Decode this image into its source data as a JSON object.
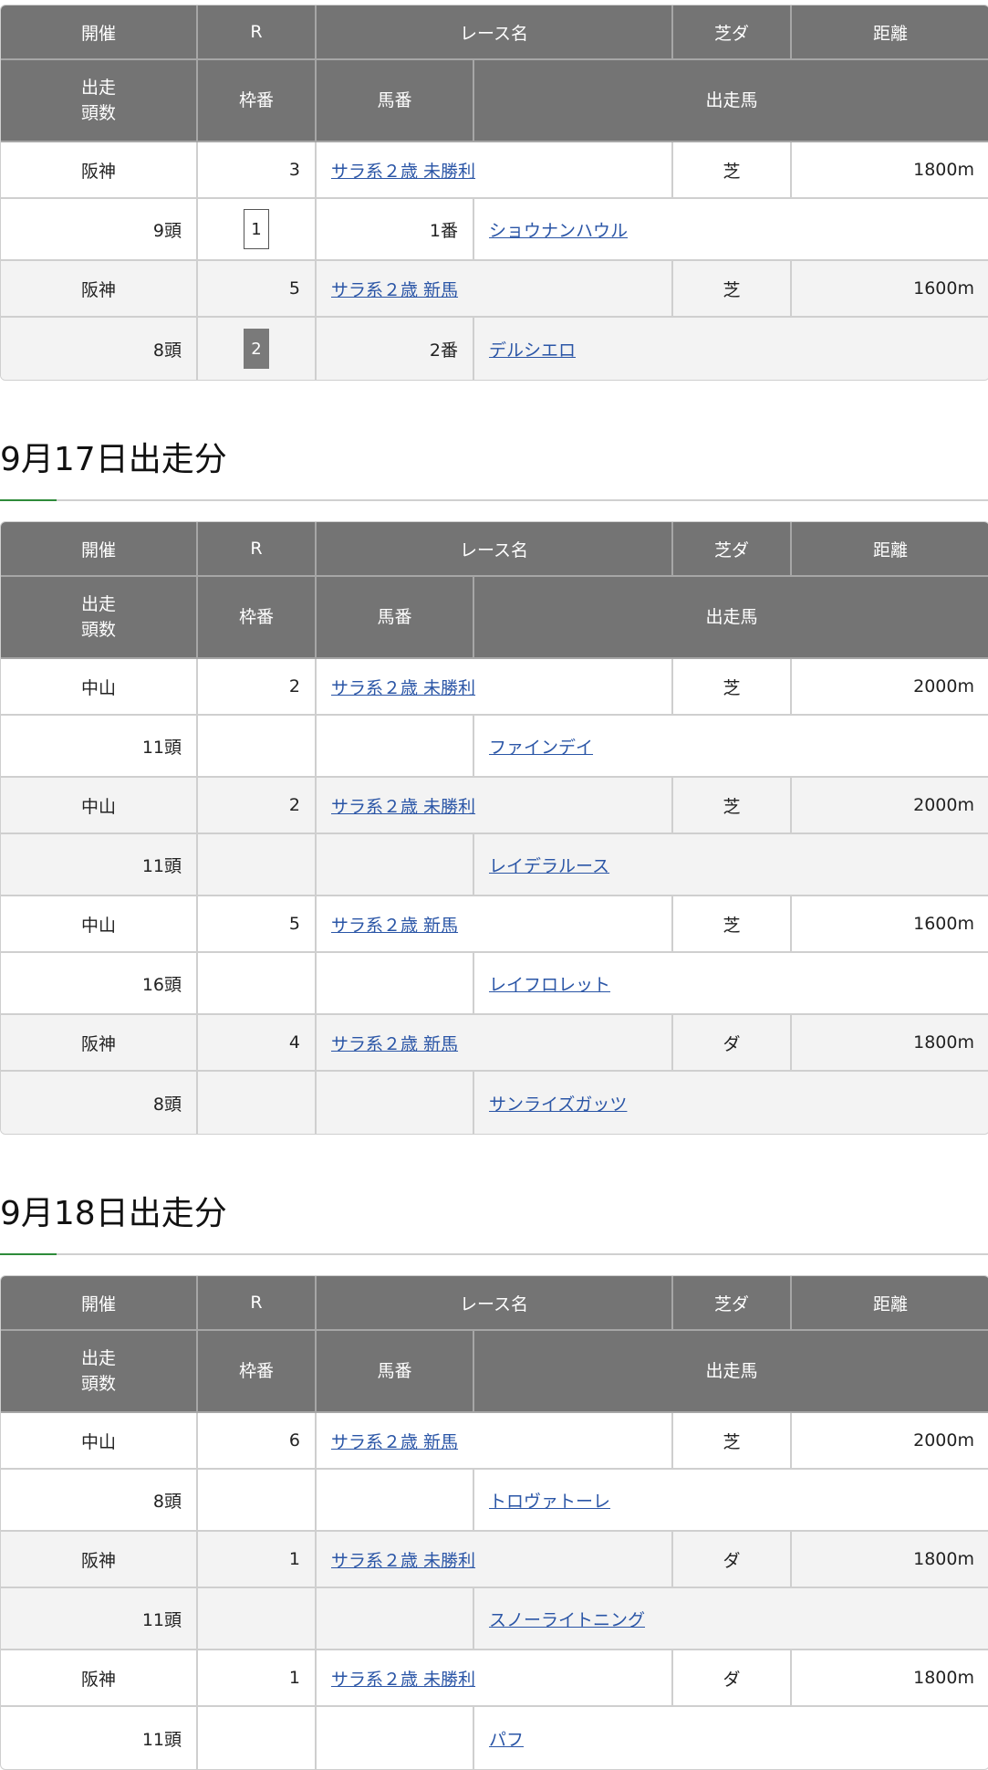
{
  "headers": {
    "venue": "開催",
    "race_no": "R",
    "race_name": "レース名",
    "surface": "芝ダ",
    "distance": "距離",
    "runners_1": "出走",
    "runners_2": "頭数",
    "frame": "枠番",
    "horse_no": "馬番",
    "horse": "出走馬"
  },
  "sections": [
    {
      "title": "",
      "entries": [
        {
          "venue": "阪神",
          "race_no": "3",
          "race_name": "サラ系２歳 未勝利",
          "surface": "芝",
          "distance": "1800m",
          "runners": "9頭",
          "frame": "1",
          "horse_no": "1番",
          "horse": "ショウナンハウル"
        },
        {
          "venue": "阪神",
          "race_no": "5",
          "race_name": "サラ系２歳 新馬",
          "surface": "芝",
          "distance": "1600m",
          "runners": "8頭",
          "frame": "2",
          "horse_no": "2番",
          "horse": "デルシエロ"
        }
      ]
    },
    {
      "title": "9月17日出走分",
      "entries": [
        {
          "venue": "中山",
          "race_no": "2",
          "race_name": "サラ系２歳 未勝利",
          "surface": "芝",
          "distance": "2000m",
          "runners": "11頭",
          "frame": "",
          "horse_no": "",
          "horse": "ファインデイ"
        },
        {
          "venue": "中山",
          "race_no": "2",
          "race_name": "サラ系２歳 未勝利",
          "surface": "芝",
          "distance": "2000m",
          "runners": "11頭",
          "frame": "",
          "horse_no": "",
          "horse": "レイデラルース"
        },
        {
          "venue": "中山",
          "race_no": "5",
          "race_name": "サラ系２歳 新馬",
          "surface": "芝",
          "distance": "1600m",
          "runners": "16頭",
          "frame": "",
          "horse_no": "",
          "horse": "レイフロレット"
        },
        {
          "venue": "阪神",
          "race_no": "4",
          "race_name": "サラ系２歳 新馬",
          "surface": "ダ",
          "distance": "1800m",
          "runners": "8頭",
          "frame": "",
          "horse_no": "",
          "horse": "サンライズガッツ"
        }
      ]
    },
    {
      "title": "9月18日出走分",
      "entries": [
        {
          "venue": "中山",
          "race_no": "6",
          "race_name": "サラ系２歳 新馬",
          "surface": "芝",
          "distance": "2000m",
          "runners": "8頭",
          "frame": "",
          "horse_no": "",
          "horse": "トロヴァトーレ"
        },
        {
          "venue": "阪神",
          "race_no": "1",
          "race_name": "サラ系２歳 未勝利",
          "surface": "ダ",
          "distance": "1800m",
          "runners": "11頭",
          "frame": "",
          "horse_no": "",
          "horse": "スノーライトニング"
        },
        {
          "venue": "阪神",
          "race_no": "1",
          "race_name": "サラ系２歳 未勝利",
          "surface": "ダ",
          "distance": "1800m",
          "runners": "11頭",
          "frame": "",
          "horse_no": "",
          "horse": "パフ"
        }
      ]
    }
  ],
  "colors": {
    "header_bg": "#747474",
    "link": "#2a55a6",
    "accent": "#2e8b3a",
    "row_shade": "#f3f3f3"
  }
}
